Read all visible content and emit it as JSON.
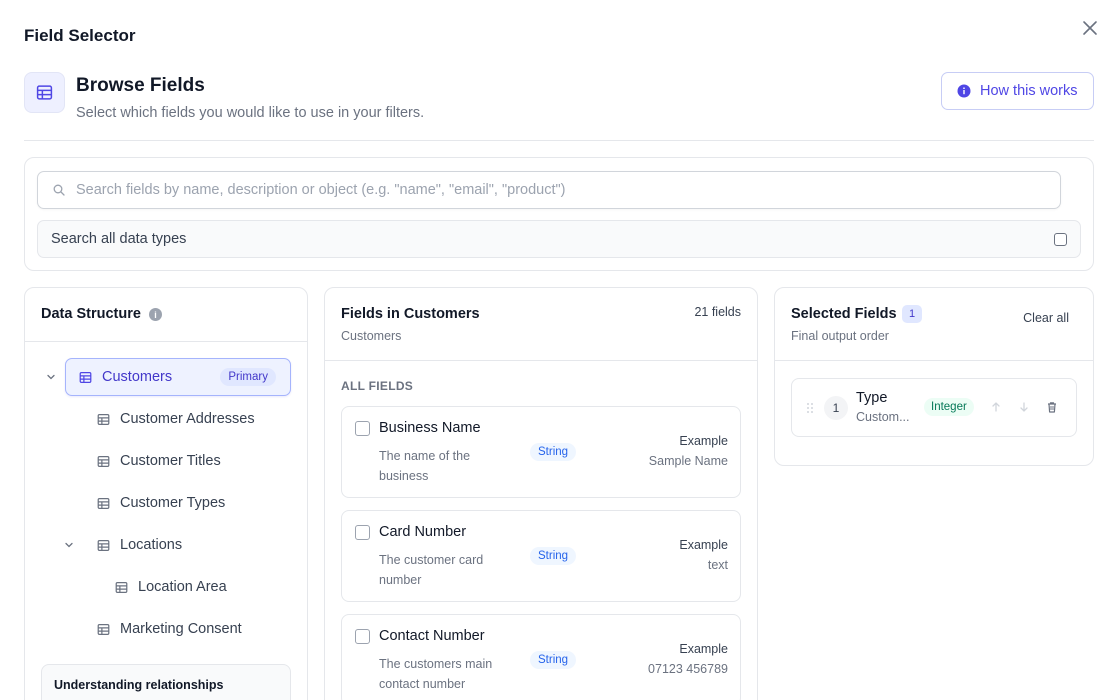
{
  "modal": {
    "title": "Field Selector"
  },
  "header": {
    "title": "Browse Fields",
    "subtitle": "Select which fields you would like to use in your filters.",
    "how_button": "How this works"
  },
  "search": {
    "placeholder": "Search fields by name, description or object (e.g. \"name\", \"email\", \"product\")",
    "all_types_label": "Search all data types"
  },
  "structure": {
    "title": "Data Structure",
    "items": [
      {
        "label": "Customers",
        "badge": "Primary"
      },
      {
        "label": "Customer Addresses"
      },
      {
        "label": "Customer Titles"
      },
      {
        "label": "Customer Types"
      },
      {
        "label": "Locations"
      },
      {
        "label": "Location Area"
      },
      {
        "label": "Marketing Consent"
      }
    ],
    "understanding_title": "Understanding relationships"
  },
  "fields": {
    "title": "Fields in Customers",
    "subtitle": "Customers",
    "count": "21 fields",
    "section_label": "ALL FIELDS",
    "items": [
      {
        "name": "Business Name",
        "description": "The name of the business",
        "type": "String",
        "example_label": "Example",
        "example_value": "Sample Name"
      },
      {
        "name": "Card Number",
        "description": "The customer card number",
        "type": "String",
        "example_label": "Example",
        "example_value": "text"
      },
      {
        "name": "Contact Number",
        "description": "The customers main contact number",
        "type": "String",
        "example_label": "Example",
        "example_value": "07123 456789"
      }
    ]
  },
  "selected": {
    "title": "Selected Fields",
    "count": "1",
    "subtitle": "Final output order",
    "clear_label": "Clear all",
    "items": [
      {
        "order": "1",
        "name": "Type",
        "source": "Custom...",
        "type": "Integer"
      }
    ]
  },
  "colors": {
    "accent": "#4f46e5",
    "string_badge": "#2563eb",
    "integer_badge": "#047857"
  }
}
